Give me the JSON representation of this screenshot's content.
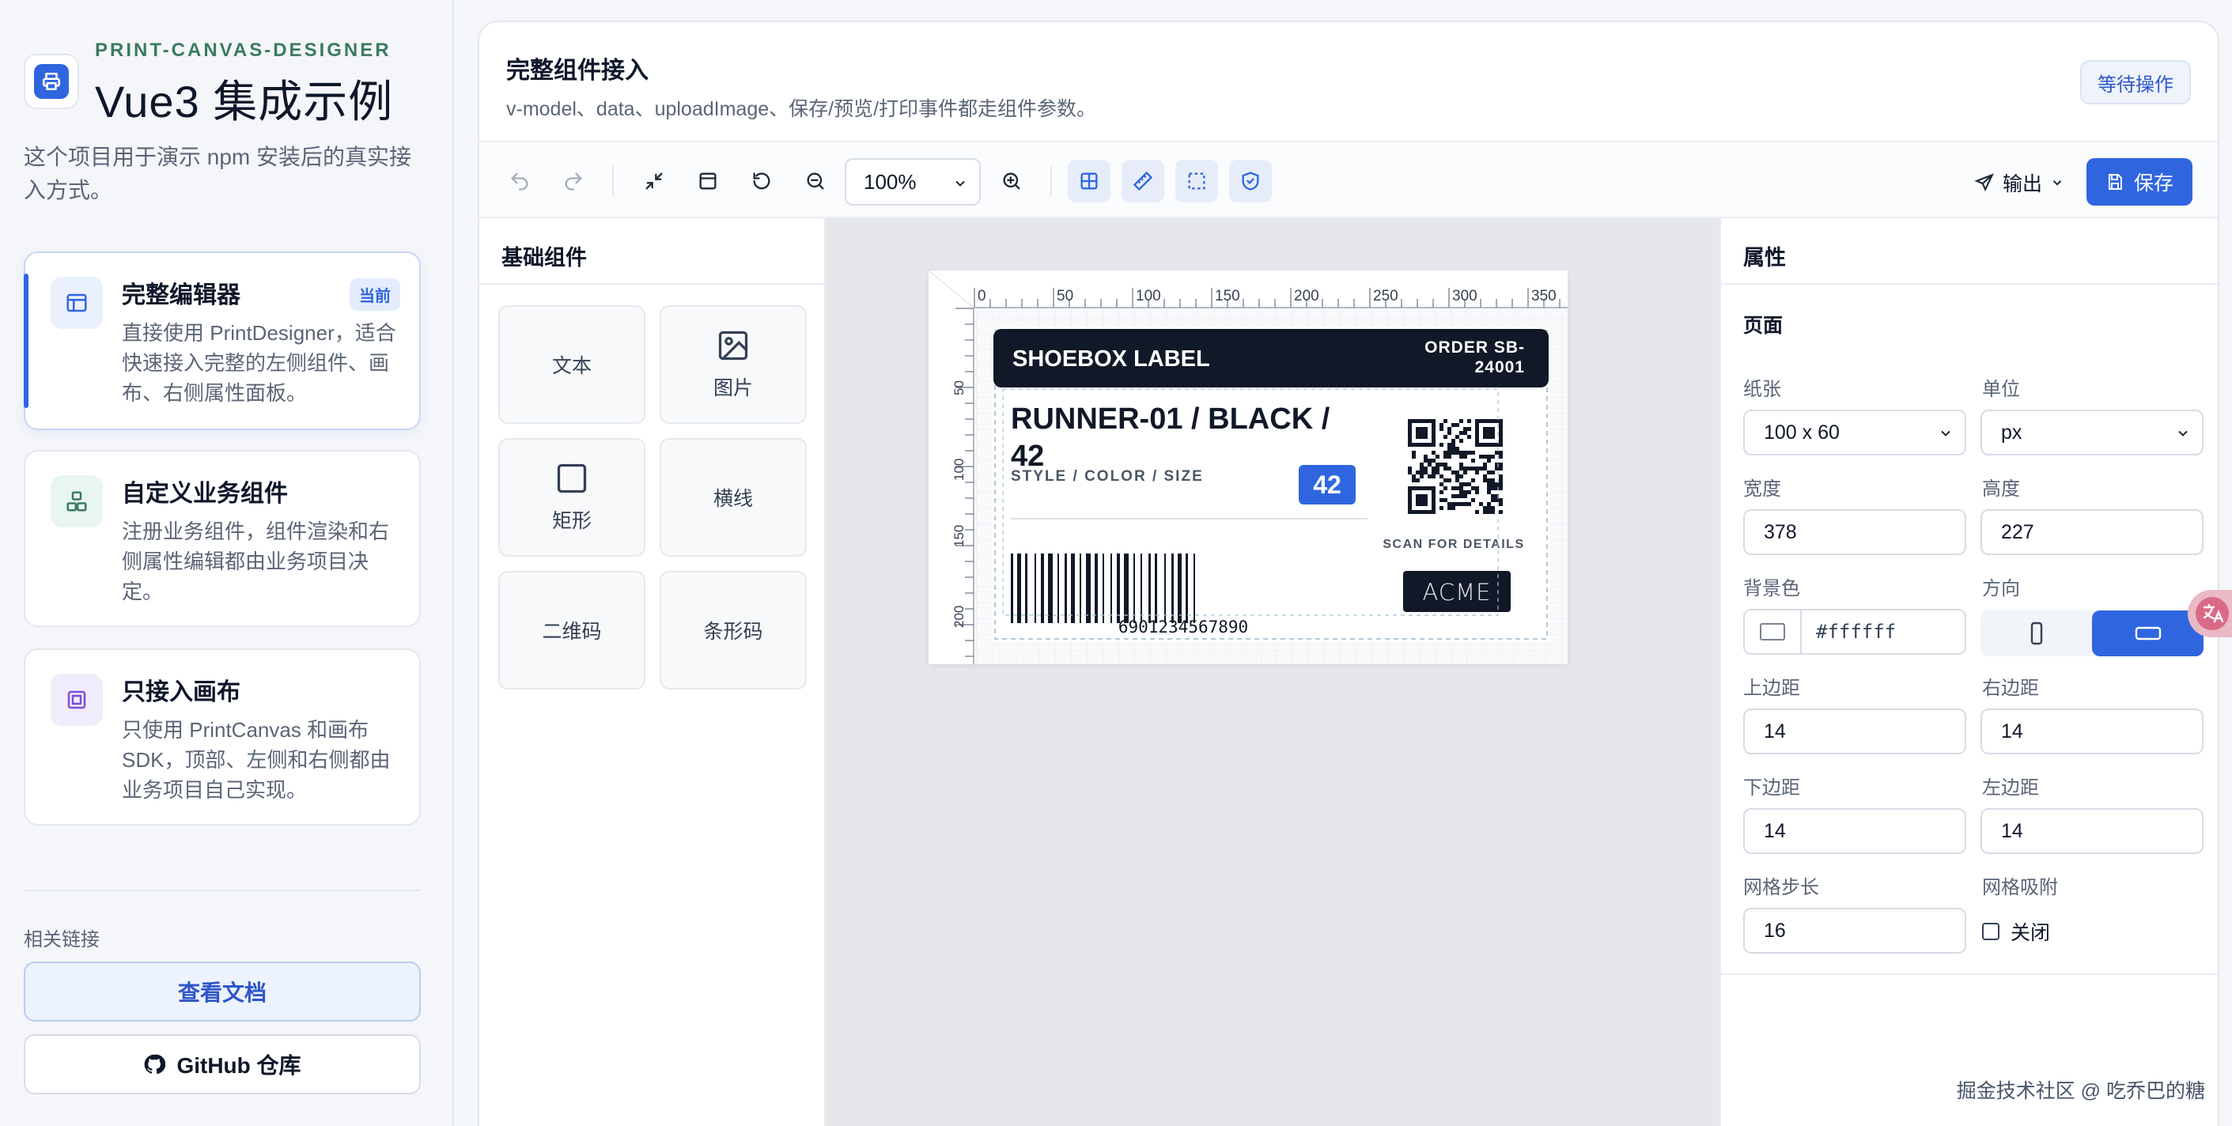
{
  "brand": {
    "kicker": "PRINT-CANVAS-DESIGNER",
    "title": "Vue3 集成示例",
    "description": "这个项目用于演示 npm 安装后的真实接入方式。"
  },
  "nav": [
    {
      "title": "完整编辑器",
      "desc": "直接使用 PrintDesigner，适合快速接入完整的左侧组件、画布、右侧属性面板。",
      "badge": "当前"
    },
    {
      "title": "自定义业务组件",
      "desc": "注册业务组件，组件渲染和右侧属性编辑都由业务项目决定。"
    },
    {
      "title": "只接入画布",
      "desc": "只使用 PrintCanvas 和画布 SDK，顶部、左侧和右侧都由业务项目自己实现。"
    }
  ],
  "links": {
    "label": "相关链接",
    "docs": "查看文档",
    "github": "GitHub 仓库"
  },
  "header": {
    "title": "完整组件接入",
    "subtitle": "v-model、data、uploadImage、保存/预览/打印事件都走组件参数。",
    "status": "等待操作"
  },
  "toolbar": {
    "zoom": "100%",
    "export": "输出",
    "save": "保存"
  },
  "components": {
    "title": "基础组件",
    "items": [
      "文本",
      "图片",
      "矩形",
      "横线",
      "二维码",
      "条形码"
    ]
  },
  "canvas": {
    "ruler_top": [
      "0",
      "50",
      "100",
      "150",
      "200",
      "250",
      "300",
      "350"
    ],
    "ruler_left": [
      "50",
      "100",
      "150",
      "200"
    ],
    "label": {
      "header": "SHOEBOX LABEL",
      "order_line1": "ORDER SB-",
      "order_line2": "24001",
      "product_line1": "RUNNER-01 / BLACK /",
      "product_line2": "42",
      "subtitle": "STYLE / COLOR / SIZE",
      "size_badge": "42",
      "scan_text": "SCAN FOR DETAILS",
      "barcode_number": "6901234567890",
      "brand": "ACME"
    }
  },
  "properties": {
    "title": "属性",
    "section": "页面",
    "paper_label": "纸张",
    "paper_value": "100 x 60",
    "unit_label": "单位",
    "unit_value": "px",
    "width_label": "宽度",
    "width_value": "378",
    "height_label": "高度",
    "height_value": "227",
    "bg_label": "背景色",
    "bg_value": "#ffffff",
    "direction_label": "方向",
    "direction_value": "landscape",
    "margin_top_label": "上边距",
    "margin_top_value": "14",
    "margin_right_label": "右边距",
    "margin_right_value": "14",
    "margin_bottom_label": "下边距",
    "margin_bottom_value": "14",
    "margin_left_label": "左边距",
    "margin_left_value": "14",
    "grid_step_label": "网格步长",
    "grid_step_value": "16",
    "snap_label": "网格吸附",
    "snap_value": "关闭"
  },
  "watermark": "掘金技术社区 @ 吃乔巴的糖",
  "colors": {
    "accent": "#2f66e0",
    "label_dark": "#111827",
    "size_badge": "#2f66e0"
  }
}
